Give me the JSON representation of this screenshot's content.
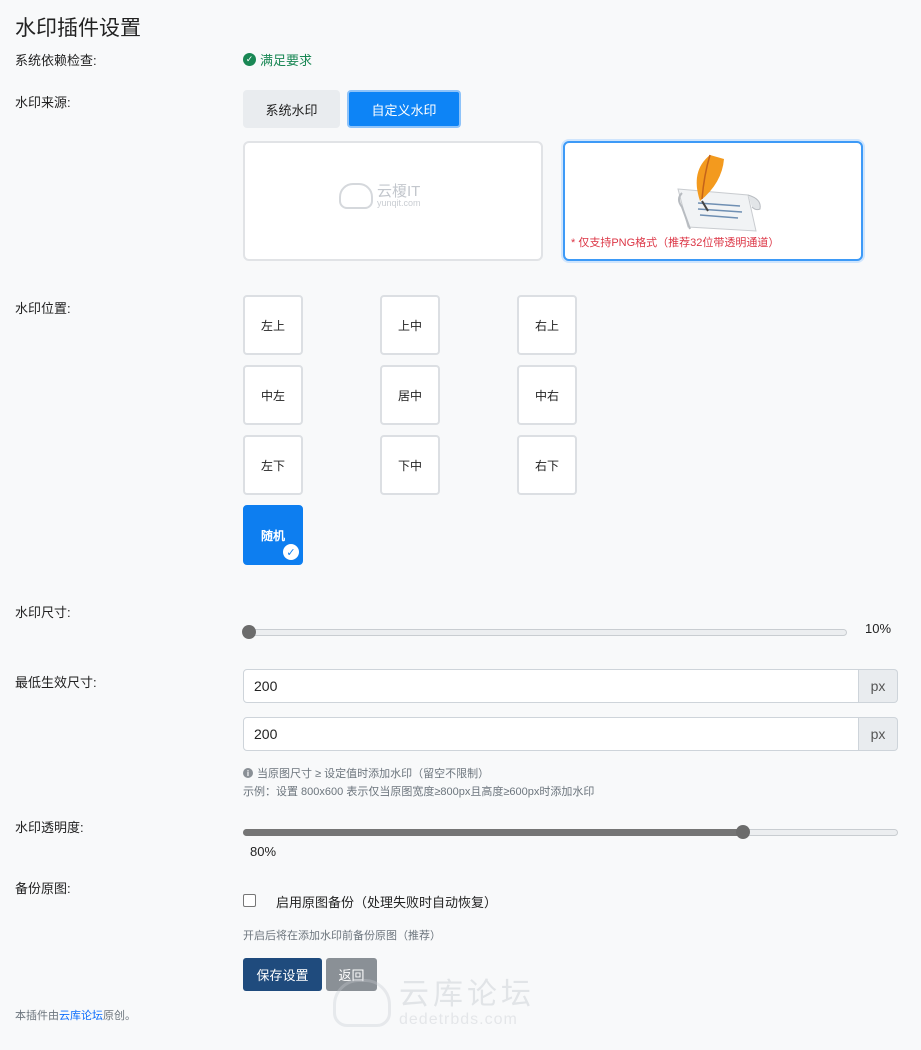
{
  "page": {
    "title": "水印插件设置"
  },
  "dependency": {
    "label": "系统依赖检查:",
    "status": "满足要求",
    "status_color": "#198754"
  },
  "source": {
    "label": "水印来源:",
    "system_label": "系统水印",
    "custom_label": "自定义水印",
    "selected": "custom",
    "system_preview": {
      "logo_text": "云榎IT",
      "logo_sub": "yunqit.com"
    },
    "custom_preview": {
      "note": "* 仅支持PNG格式（推荐32位带透明通道）"
    }
  },
  "position": {
    "label": "水印位置:",
    "options": [
      "左上",
      "上中",
      "右上",
      "中左",
      "居中",
      "中右",
      "左下",
      "下中",
      "右下"
    ],
    "random_label": "随机",
    "selected": "随机",
    "check_glyph": "✓"
  },
  "size": {
    "label": "水印尺寸:",
    "value_percent": 10,
    "value_text": "10%"
  },
  "min_size": {
    "label": "最低生效尺寸:",
    "width_value": "200",
    "height_value": "200",
    "unit": "px",
    "hint": "当原图尺寸 ≥ 设定值时添加水印（留空不限制）",
    "example": "示例：设置 800x600 表示仅当原图宽度≥800px且高度≥600px时添加水印"
  },
  "opacity": {
    "label": "水印透明度:",
    "value_percent": 80,
    "value_text": "80%"
  },
  "backup": {
    "label": "备份原图:",
    "checkbox_label": "启用原图备份（处理失败时自动恢复）",
    "checked": false,
    "hint": "开启后将在添加水印前备份原图（推荐）"
  },
  "actions": {
    "save_label": "保存设置",
    "back_label": "返回"
  },
  "footer": {
    "prefix": "本插件由",
    "link": "云库论坛",
    "suffix": "原创。"
  },
  "watermark": {
    "text": "云库论坛",
    "sub": "dedetrbds.com"
  },
  "colors": {
    "primary": "#0d84f6",
    "danger": "#dc3545",
    "save": "#1f4b7d",
    "back": "#8a9096"
  }
}
